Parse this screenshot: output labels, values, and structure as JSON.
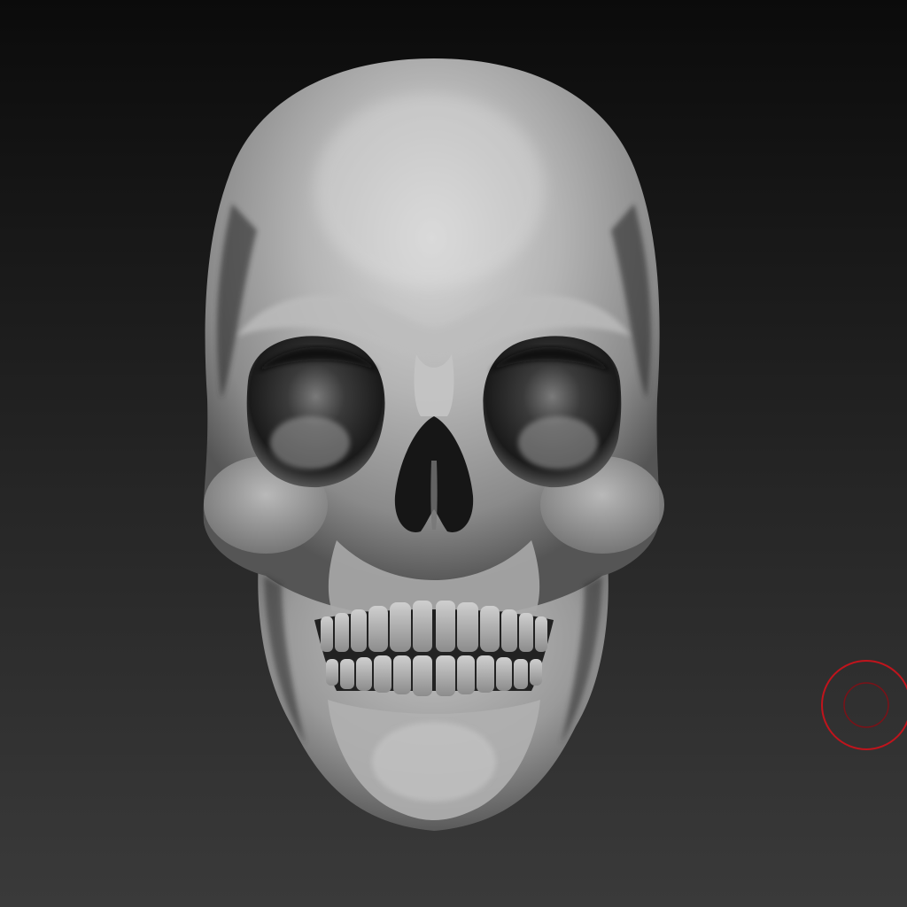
{
  "viewport": {
    "background_top_color": "#0b0b0b",
    "background_bottom_color": "#3a3a3a"
  },
  "model": {
    "icon": "skull-sculpt-icon",
    "material_light": "#d2d2d2",
    "material_mid": "#9a9a9a",
    "material_shadow": "#3a3a3a",
    "cavity_color": "#141414"
  },
  "brush_cursor": {
    "icon": "brush-cursor-icon",
    "color": "#c0141c"
  }
}
